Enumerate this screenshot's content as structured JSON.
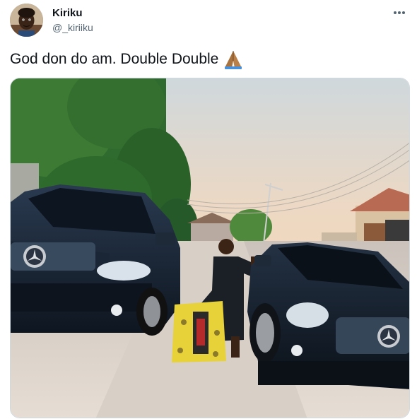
{
  "tweet": {
    "author": {
      "display_name": "Kiriku",
      "handle": "@_kiriiku"
    },
    "text": "God don do am. Double Double",
    "emoji": "folded-hands-emoji"
  },
  "icons": {
    "more": "more-horizontal-icon",
    "avatar": "avatar-photo"
  },
  "colors": {
    "text_primary": "#0f1419",
    "text_secondary": "#536471",
    "border": "#cfd9de"
  }
}
